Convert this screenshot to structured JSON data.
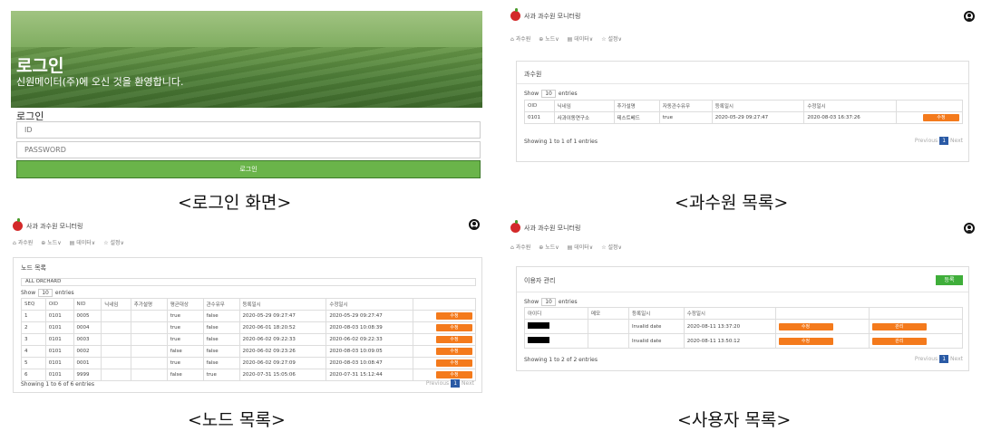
{
  "login": {
    "title": "로그인",
    "subtitle": "신원메이터(주)에 오신 것을 환영합니다.",
    "form_label": "로그인",
    "id_placeholder": "ID",
    "password_placeholder": "PASSWORD",
    "button": "로그인",
    "caption": "<로그인 화면>"
  },
  "orchard": {
    "app_title": "사과 과수원 모니터링",
    "nav": [
      "과수원",
      "노드∨",
      "데이터∨",
      "설정∨"
    ],
    "card_title": "과수원",
    "show": "Show",
    "show_value": "10",
    "entries": "entries",
    "columns": [
      "OID",
      "닉네임",
      "추가설명",
      "자동관수유무",
      "등록일시",
      "수정일시",
      ""
    ],
    "rows": [
      [
        "0101",
        "사과이동연구소",
        "테스트베드",
        "true",
        "2020-05-29 09:27:47",
        "2020-08-03 16:37:26",
        "수정"
      ]
    ],
    "footer": "Showing 1 to 1 of 1 entries",
    "prev": "Previous",
    "page": "1",
    "next": "Next",
    "caption": "<과수원 목록>"
  },
  "node": {
    "app_title": "사과 과수원 모니터링",
    "nav": [
      "과수원",
      "노드∨",
      "데이터∨",
      "설정∨"
    ],
    "card_title": "노드 목록",
    "filter": "ALL ORCHARD",
    "show": "Show",
    "show_value": "10",
    "entries": "entries",
    "columns": [
      "SEQ",
      "OID",
      "NID",
      "닉네임",
      "추가설명",
      "평균대상",
      "관수유무",
      "등록일시",
      "수정일시",
      ""
    ],
    "rows": [
      [
        "1",
        "0101",
        "0005",
        "",
        "",
        "true",
        "false",
        "2020-05-29 09:27:47",
        "2020-05-29 09:27:47",
        "수정"
      ],
      [
        "2",
        "0101",
        "0004",
        "",
        "",
        "true",
        "false",
        "2020-06-01 18:20:52",
        "2020-08-03 10:08:39",
        "수정"
      ],
      [
        "3",
        "0101",
        "0003",
        "",
        "",
        "true",
        "false",
        "2020-06-02 09:22:33",
        "2020-06-02 09:22:33",
        "수정"
      ],
      [
        "4",
        "0101",
        "0002",
        "",
        "",
        "false",
        "false",
        "2020-06-02 09:23:26",
        "2020-08-03 10:09:05",
        "수정"
      ],
      [
        "5",
        "0101",
        "0001",
        "",
        "",
        "true",
        "false",
        "2020-06-02 09:27:09",
        "2020-08-03 10:08:47",
        "수정"
      ],
      [
        "6",
        "0101",
        "9999",
        "",
        "",
        "false",
        "true",
        "2020-07-31 15:05:06",
        "2020-07-31 15:12:44",
        "수정"
      ]
    ],
    "footer": "Showing 1 to 6 of 6 entries",
    "prev": "Previous",
    "page": "1",
    "next": "Next",
    "caption": "<노드 목록>"
  },
  "users": {
    "app_title": "사과 과수원 모니터링",
    "nav": [
      "과수원",
      "노드∨",
      "데이터∨",
      "설정∨"
    ],
    "card_title": "이용자 관리",
    "add_button": "등록",
    "show": "Show",
    "show_value": "10",
    "entries": "entries",
    "columns": [
      "아이디",
      "메모",
      "등록일시",
      "수정일시",
      "",
      ""
    ],
    "rows": [
      [
        "",
        "",
        "Invalid date",
        "2020-08-11 13:37:20",
        "수정",
        "관리"
      ],
      [
        "",
        "",
        "Invalid date",
        "2020-08-11 13:50:12",
        "수정",
        "관리"
      ]
    ],
    "footer": "Showing 1 to 2 of 2 entries",
    "prev": "Previous",
    "page": "1",
    "next": "Next",
    "caption": "<사용자 목록>"
  }
}
